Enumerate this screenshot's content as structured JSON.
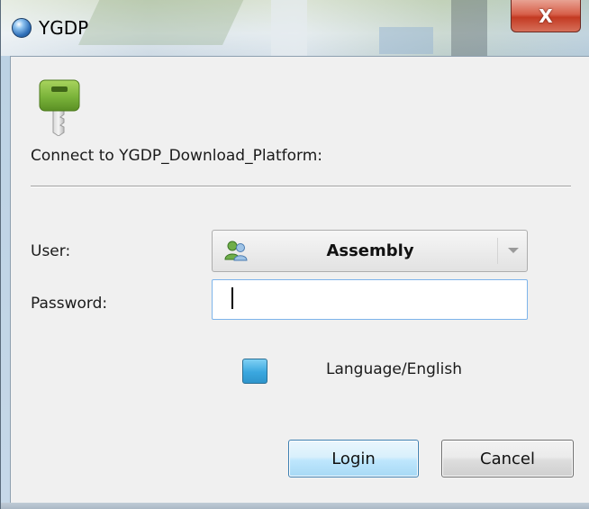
{
  "window": {
    "title": "YGDP",
    "close_label": "X"
  },
  "dialog": {
    "connect_text": "Connect to YGDP_Download_Platform:",
    "user_label": "User:",
    "user_value": "Assembly",
    "password_label": "Password:",
    "password_value": "",
    "language_label": "Language/English"
  },
  "buttons": {
    "login": "Login",
    "cancel": "Cancel"
  },
  "icons": {
    "app": "globe-icon",
    "key": "key-icon",
    "user": "users-icon",
    "dropdown": "chevron-down-icon"
  },
  "colors": {
    "accent_blue": "#3aa7df",
    "key_green": "#7ab33a",
    "close_red": "#c33a22"
  }
}
